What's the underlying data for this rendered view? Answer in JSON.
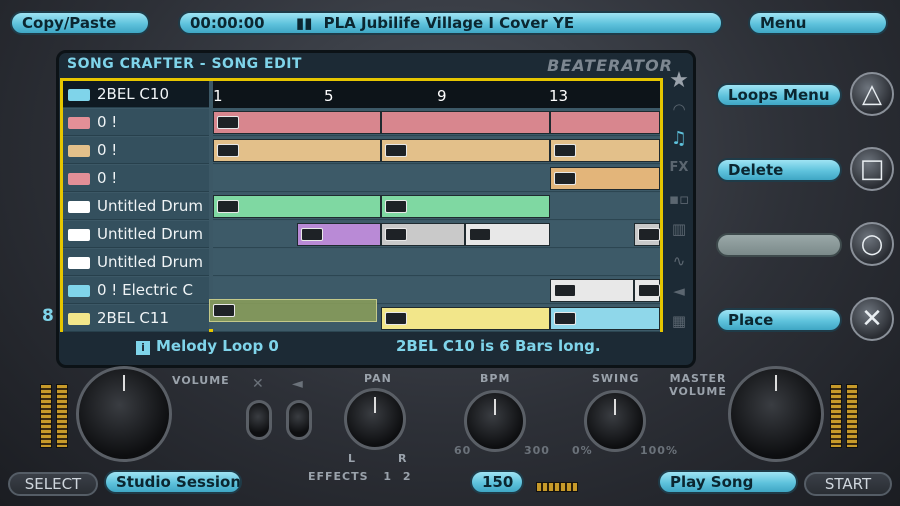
{
  "top": {
    "copy_paste": "Copy/Paste",
    "time": "00:00:00",
    "song": "PLA Jubilife Village I Cover YE",
    "menu": "Menu"
  },
  "screen": {
    "title": "SONG CRAFTER - SONG EDIT",
    "brand": "BEATERATOR",
    "ruler": [
      "1",
      "5",
      "9",
      "13"
    ],
    "tracks": [
      {
        "name": "2BEL C10",
        "type": "melody"
      },
      {
        "name": "0 !",
        "type": "pink"
      },
      {
        "name": "0 !",
        "type": "tan"
      },
      {
        "name": "0 !",
        "type": "pink"
      },
      {
        "name": "Untitled Drum",
        "type": "drum"
      },
      {
        "name": "Untitled Drum",
        "type": "drum"
      },
      {
        "name": "Untitled Drum",
        "type": "drum"
      },
      {
        "name": "0 ! Electric C",
        "type": "electric"
      },
      {
        "name": "2BEL C11",
        "type": "melody"
      }
    ],
    "status_left": "Melody Loop 0",
    "status_right": "2BEL C10 is 6 Bars long.",
    "track_number": "8"
  },
  "right_menu": {
    "loops_menu": "Loops Menu",
    "delete": "Delete",
    "place": "Place"
  },
  "face_buttons": {
    "triangle": "△",
    "square": "□",
    "circle": "○",
    "cross": "✕"
  },
  "controls": {
    "volume": "VOLUME",
    "pan": "PAN",
    "pan_l": "L",
    "pan_r": "R",
    "bpm_label": "BPM",
    "bpm_min": "60",
    "bpm_max": "300",
    "swing_label": "SWING",
    "swing_min": "0%",
    "swing_max": "100%",
    "master_volume": "MASTER VOLUME",
    "effects": "EFFECTS",
    "effects_1": "1",
    "effects_2": "2"
  },
  "bottom": {
    "select": "SELECT",
    "studio_session": "Studio Session",
    "bpm_value": "150",
    "play_song": "Play Song",
    "start": "START"
  }
}
